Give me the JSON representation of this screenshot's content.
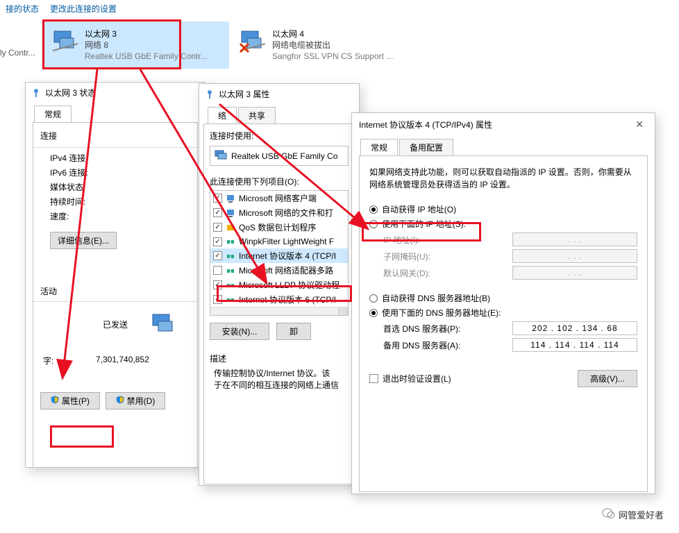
{
  "menu": {
    "status": "接的状态",
    "change": "更改此连接的设置"
  },
  "sidebar_item": "ly Contr...",
  "adapters": [
    {
      "name": "以太网 3",
      "line2": "网络 8",
      "line3": "Realtek USB GbE Family Contr..."
    },
    {
      "name": "以太网 4",
      "line2": "网络电缆被拔出",
      "line3": "Sangfor SSL VPN CS Support ..."
    }
  ],
  "statusDlg": {
    "title": "以太网 3 状态",
    "tab": "常规",
    "group_conn": "连接",
    "ipv4": "IPv4 连接:",
    "ipv6": "IPv6 连接:",
    "media": "媒体状态:",
    "duration": "持续时间:",
    "speed": "速度:",
    "details": "详细信息(E)...",
    "group_act": "活动",
    "sent": "已发送",
    "bytes_lbl": "字:",
    "bytes_val": "7,301,740,852",
    "props": "属性(P)",
    "disable": "禁用(D)"
  },
  "propDlg": {
    "title": "以太网 3 属性",
    "tab_net": "络",
    "tab_share": "共享",
    "connect_using": "连接时使用:",
    "nic": "Realtek USB GbE Family Co",
    "uses_items": "此连接使用下列项目(O):",
    "items": [
      "Microsoft 网络客户端",
      "Microsoft 网络的文件和打",
      "QoS 数据包计划程序",
      "WinpkFilter LightWeight F",
      "Internet 协议版本 4 (TCP/I",
      "Microsoft 网络适配器多路",
      "Microsoft LLDP 协议驱动程",
      "Internet 协议版本 6 (TCP/I"
    ],
    "install": "安装(N)...",
    "uninstall": "卸",
    "desc_hdr": "描述",
    "desc": "传输控制协议/Internet 协议。该\n于在不同的相互连接的网络上通信"
  },
  "ipDlg": {
    "title": "Internet 协议版本 4 (TCP/IPv4) 属性",
    "tab_general": "常规",
    "tab_backup": "备用配置",
    "intro": "如果网络支持此功能，则可以获取自动指派的 IP 设置。否则，你需要从网络系统管理员处获得适当的 IP 设置。",
    "auto_ip": "自动获得 IP 地址(O)",
    "manual_ip": "使用下面的 IP 地址(S):",
    "ip_lbl": "IP 地址(I):",
    "mask_lbl": "子网掩码(U):",
    "gw_lbl": "默认网关(D):",
    "auto_dns": "自动获得 DNS 服务器地址(B)",
    "manual_dns": "使用下面的 DNS 服务器地址(E):",
    "dns1_lbl": "首选 DNS 服务器(P):",
    "dns1": "202 . 102 . 134 .  68",
    "dns2_lbl": "备用 DNS 服务器(A):",
    "dns2": "114 . 114 . 114 . 114",
    "validate": "退出时验证设置(L)",
    "advanced": "高级(V)...",
    "dots": "  .        .        .  "
  },
  "watermark": "网管爱好者"
}
